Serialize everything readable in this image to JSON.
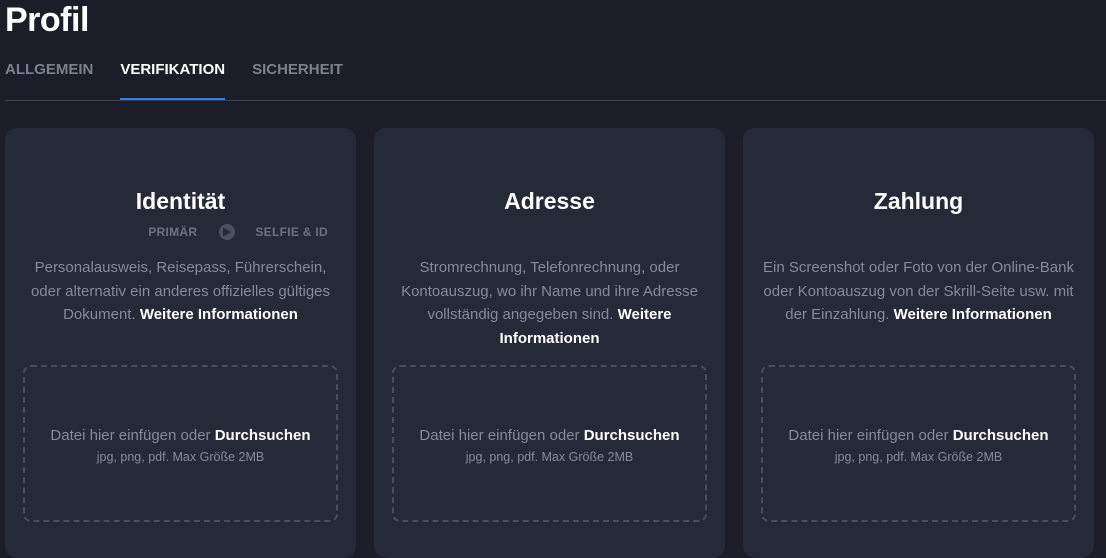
{
  "page": {
    "title": "Profil"
  },
  "tabs": [
    {
      "label": "ALLGEMEIN"
    },
    {
      "label": "VERIFIKATION"
    },
    {
      "label": "SICHERHEIT"
    }
  ],
  "accent_color": "#2f80ed",
  "cards": [
    {
      "title": "Identität",
      "steps": [
        "PRIMÄR",
        "SELFIE & ID"
      ],
      "description": "Personalausweis, Reisepass, Führerschein, oder alternativ ein anderes offizielles gültiges Dokument.",
      "more_link": "Weitere Informationen",
      "drop_text": "Datei hier einfügen oder",
      "browse_link": "Durchsuchen",
      "drop_hint": "jpg, png, pdf. Max Größe 2MB"
    },
    {
      "title": "Adresse",
      "description": "Stromrechnung, Telefonrechnung, oder Kontoauszug, wo ihr Name und ihre Adresse vollständig angegeben sind.",
      "more_link": "Weitere Informationen",
      "drop_text": "Datei hier einfügen oder",
      "browse_link": "Durchsuchen",
      "drop_hint": "jpg, png, pdf. Max Größe 2MB"
    },
    {
      "title": "Zahlung",
      "description": "Ein Screenshot oder Foto von der Online-Bank oder Kontoauszug von der Skrill-Seite usw. mit der Einzahlung.",
      "more_link": "Weitere Informationen",
      "drop_text": "Datei hier einfügen oder",
      "browse_link": "Durchsuchen",
      "drop_hint": "jpg, png, pdf. Max Größe 2MB"
    }
  ]
}
